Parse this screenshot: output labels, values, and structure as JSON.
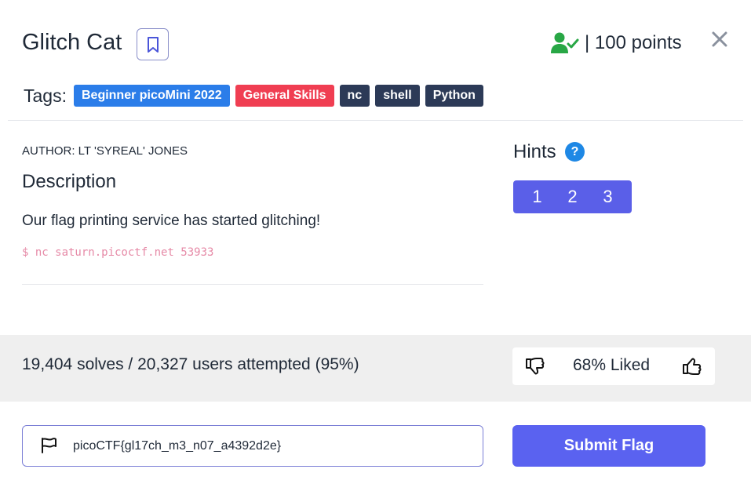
{
  "challenge": {
    "title": "Glitch Cat",
    "points_text": "| 100 points",
    "solved_icon": "user-check-icon"
  },
  "tags": {
    "label": "Tags:",
    "items": [
      {
        "text": "Beginner picoMini 2022",
        "color": "#2b7de9"
      },
      {
        "text": "General Skills",
        "color": "#f03e52"
      },
      {
        "text": "nc",
        "color": "#2c3a57"
      },
      {
        "text": "shell",
        "color": "#2c3a57"
      },
      {
        "text": "Python",
        "color": "#2c3a57"
      }
    ]
  },
  "details": {
    "author": "AUTHOR: LT 'SYREAL' JONES",
    "description_heading": "Description",
    "description": "Our flag printing service has started glitching!",
    "command": "$ nc saturn.picoctf.net 53933"
  },
  "hints": {
    "label": "Hints",
    "help_glyph": "?",
    "buttons": [
      "1",
      "2",
      "3"
    ]
  },
  "stats": {
    "solves_text": "19,404 solves / 20,327 users attempted (95%)",
    "liked_text": "68% Liked"
  },
  "flag": {
    "value": "picoCTF{gl17ch_m3_n07_a4392d2e}",
    "submit_label": "Submit Flag"
  },
  "colors": {
    "accent": "#5a62f0",
    "solved_green": "#28a745",
    "hint_blue": "#1e88e5"
  }
}
